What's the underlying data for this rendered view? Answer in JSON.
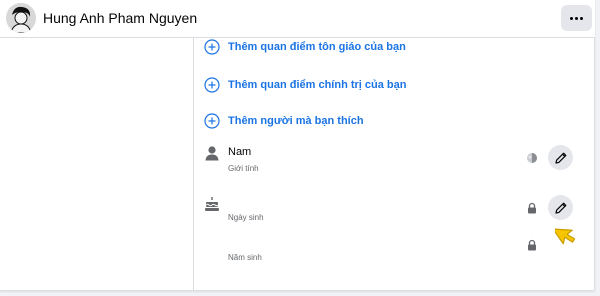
{
  "header": {
    "name": "Hung Anh Pham Nguyen",
    "avatar_icon": "person-silhouette-avatar",
    "more_icon": "more-horizontal-icon"
  },
  "add_links": [
    {
      "label": "Thêm quan điểm tôn giáo của bạn",
      "icon": "plus-circle-icon"
    },
    {
      "label": "Thêm quan điểm chính trị của bạn",
      "icon": "plus-circle-icon"
    },
    {
      "label": "Thêm người mà bạn thích",
      "icon": "plus-circle-icon"
    }
  ],
  "rows": [
    {
      "value": "Nam",
      "sublabel": "Giới tính",
      "icon": "person-icon",
      "privacy_icon": "globe-icon",
      "edit_icon": "pencil-icon"
    },
    {
      "value": "",
      "sublabel": "Ngày sinh",
      "icon": "birthday-cake-icon",
      "privacy_icon": "lock-icon",
      "edit_icon": "pencil-icon"
    },
    {
      "value": "",
      "sublabel": "Năm sinh",
      "icon": "",
      "privacy_icon": "lock-icon"
    }
  ],
  "colors": {
    "accent": "#1b74e4",
    "text_primary": "#050505",
    "text_secondary": "#65676b",
    "button_bg": "#e4e6eb",
    "cursor": "#f7c600"
  }
}
